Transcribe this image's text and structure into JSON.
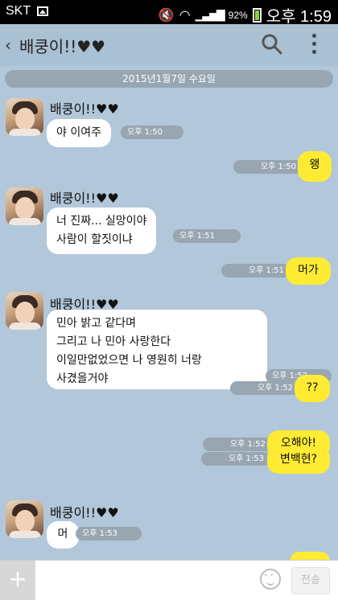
{
  "status_bar": {
    "carrier": "SKT",
    "battery": "92%",
    "time": "오후 1:59"
  },
  "header": {
    "title": "배쿵이!!♥♥"
  },
  "date_divider": "2015년1월7일 수요일",
  "messages": [
    {
      "from": "other",
      "sender": "배쿵이!!♥♥",
      "text": "야 이여주",
      "time": "오후 1:50"
    },
    {
      "from": "me",
      "text": "왱",
      "time": "오후 1:50"
    },
    {
      "from": "other",
      "sender": "배쿵이!!♥♥",
      "text": "너 진짜... 실망이야\n사람이 할짓이냐",
      "time": "오후 1:51"
    },
    {
      "from": "me",
      "text": "머가",
      "time": "오후 1:51"
    },
    {
      "from": "other",
      "sender": "배쿵이!!♥♥",
      "text": "민아 밝고 같다며\n그리고 나 민아 사랑한다\n이일만없었으면 나 영원히 너랑\n사겼을거야",
      "time": "오후 1:52"
    },
    {
      "from": "me",
      "text": "??",
      "time": "오후 1:52"
    },
    {
      "from": "me",
      "text": "오해야!",
      "time": "오후 1:52"
    },
    {
      "from": "me",
      "text": "변백현?",
      "time": "오후 1:53"
    },
    {
      "from": "other",
      "sender": "배쿵이!!♥♥",
      "text": "머",
      "time": "오후 1:53"
    }
  ],
  "input": {
    "send_label": "전송"
  },
  "colors": {
    "background": "#b2c7d9",
    "my_bubble": "#ffeb33",
    "their_bubble": "#ffffff",
    "time_pill": "#98a6b2"
  }
}
